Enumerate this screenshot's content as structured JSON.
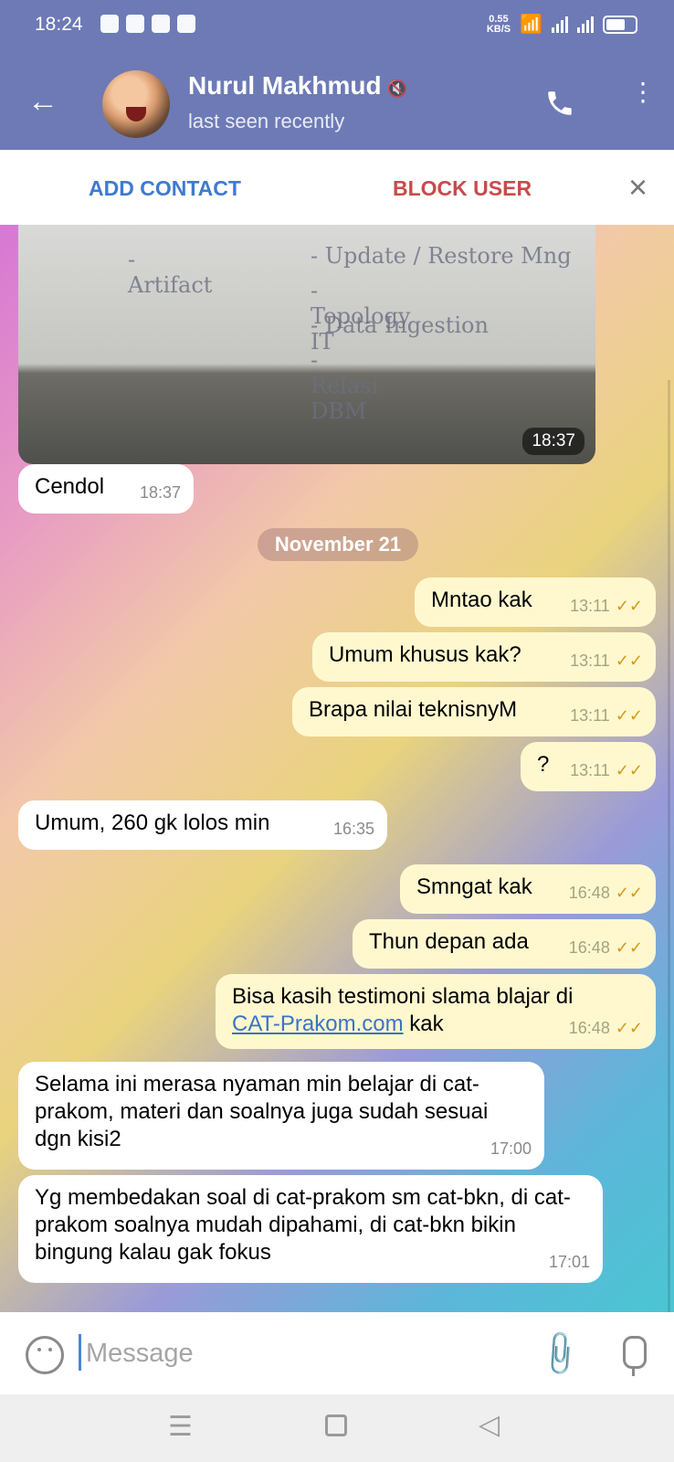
{
  "status_bar": {
    "time": "18:24",
    "net_speed": "0.55\nKB/S"
  },
  "header": {
    "title": "Nurul Makhmud",
    "subtitle": "last seen recently",
    "icons": [
      "back-arrow-icon",
      "mute-icon",
      "phone-icon",
      "more-vert-icon"
    ]
  },
  "action_bar": {
    "add_contact": "ADD CONTACT",
    "block_user": "BLOCK USER"
  },
  "photo": {
    "time": "18:37",
    "notes": [
      "- Update / Restore Mng",
      "- Topology IT",
      "- Data Ingestion",
      "- Relasi DBM"
    ],
    "left_note": "- Artifact"
  },
  "date_divider": "November 21",
  "messages": [
    {
      "dir": "in",
      "text": "Cendol",
      "time": "18:37"
    },
    {
      "dir": "out",
      "text": "Mntao kak",
      "time": "13:11"
    },
    {
      "dir": "out",
      "text": "Umum khusus kak?",
      "time": "13:11"
    },
    {
      "dir": "out",
      "text": "Brapa nilai teknisnyM",
      "time": "13:11"
    },
    {
      "dir": "out",
      "text": "?",
      "time": "13:11"
    },
    {
      "dir": "in",
      "text": "Umum, 260 gk lolos min",
      "time": "16:35"
    },
    {
      "dir": "out",
      "text": "Smngat kak",
      "time": "16:48"
    },
    {
      "dir": "out",
      "text": "Thun depan ada",
      "time": "16:48"
    },
    {
      "dir": "out",
      "text_1": "Bisa kasih testimoni slama blajar di",
      "link": "CAT-Prakom.com",
      "text_2": " kak",
      "time": "16:48"
    },
    {
      "dir": "in",
      "text": "Selama ini merasa nyaman min belajar di cat-prakom, materi dan soalnya juga sudah sesuai dgn kisi2",
      "time": "17:00"
    },
    {
      "dir": "in",
      "text": "Yg membedakan soal di cat-prakom sm cat-bkn, di cat-prakom soalnya mudah dipahami, di cat-bkn bikin bingung kalau gak fokus",
      "time": "17:01"
    }
  ],
  "composer": {
    "placeholder": "Message"
  }
}
